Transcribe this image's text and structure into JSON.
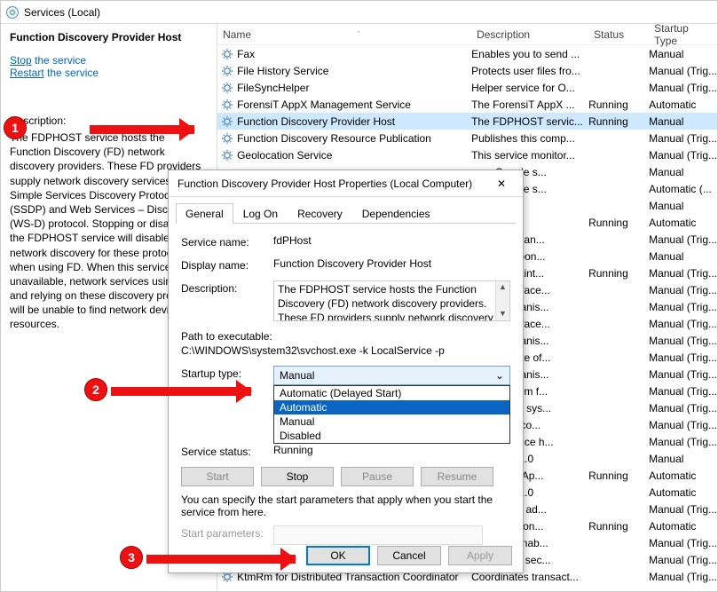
{
  "toolbar": {
    "title": "Services (Local)"
  },
  "left": {
    "title": "Function Discovery Provider Host",
    "stop_pre": "Stop",
    "stop_post": " the service",
    "restart_pre": "Restart",
    "restart_post": " the service",
    "desc_label": "Description:",
    "desc": "The FDPHOST service hosts the Function Discovery (FD) network discovery providers. These FD providers supply network discovery services for the Simple Services Discovery Protocol (SSDP) and Web Services – Discovery (WS-D) protocol. Stopping or disabling the FDPHOST service will disable network discovery for these protocols when using FD. When this service is unavailable, network services using FD and relying on these discovery protocols will be unable to find network devices or resources."
  },
  "columns": {
    "name": "Name",
    "desc": "Description",
    "status": "Status",
    "startup": "Startup Type"
  },
  "rows": [
    {
      "name": "Fax",
      "desc": "Enables you to send ...",
      "status": "",
      "startup": "Manual"
    },
    {
      "name": "File History Service",
      "desc": "Protects user files fro...",
      "status": "",
      "startup": "Manual (Trig..."
    },
    {
      "name": "FileSyncHelper",
      "desc": "Helper service for O...",
      "status": "",
      "startup": "Manual (Trig..."
    },
    {
      "name": "ForensiT AppX Management Service",
      "desc": "The ForensiT AppX ...",
      "status": "Running",
      "startup": "Automatic"
    },
    {
      "name": "Function Discovery Provider Host",
      "desc": "The FDPHOST servic...",
      "status": "Running",
      "startup": "Manual",
      "sel": true
    },
    {
      "name": "Function Discovery Resource Publication",
      "desc": "Publishes this comp...",
      "status": "",
      "startup": "Manual (Trig..."
    },
    {
      "name": "Geolocation Service",
      "desc": "This service monitor...",
      "status": "",
      "startup": "Manual (Trig..."
    },
    {
      "name": "",
      "desc": "your Google s...",
      "status": "",
      "startup": "Manual"
    },
    {
      "name": "",
      "desc": "your Google s...",
      "status": "",
      "startup": "Automatic (..."
    },
    {
      "name": "",
      "desc": "",
      "status": "",
      "startup": "Manual"
    },
    {
      "name": "",
      "desc": "",
      "status": "Running",
      "startup": "Automatic"
    },
    {
      "name": "",
      "desc": "ics performan...",
      "status": "",
      "startup": "Manual (Trig..."
    },
    {
      "name": "",
      "desc": "vice is respon...",
      "status": "",
      "startup": "Manual"
    },
    {
      "name": "",
      "desc": "tes and maint...",
      "status": "Running",
      "startup": "Manual (Trig..."
    },
    {
      "name": "",
      "desc": "es an interface...",
      "status": "",
      "startup": "Manual (Trig..."
    },
    {
      "name": "",
      "desc": "es a mechanis...",
      "status": "",
      "startup": "Manual (Trig..."
    },
    {
      "name": "",
      "desc": "es an interface...",
      "status": "",
      "startup": "Manual (Trig..."
    },
    {
      "name": "",
      "desc": "es a mechanis...",
      "status": "",
      "startup": "Manual (Trig..."
    },
    {
      "name": "",
      "desc": "ors the state of...",
      "status": "",
      "startup": "Manual (Trig..."
    },
    {
      "name": "",
      "desc": "es a mechanis...",
      "status": "",
      "startup": "Manual (Trig..."
    },
    {
      "name": "",
      "desc": "es a platform f...",
      "status": "",
      "startup": "Manual (Trig..."
    },
    {
      "name": "",
      "desc": "ronizes the sys...",
      "status": "",
      "startup": "Manual (Trig..."
    },
    {
      "name": "",
      "desc": "inates the co...",
      "status": "",
      "startup": "Manual (Trig..."
    },
    {
      "name": "",
      "desc": "EEXT service h...",
      "status": "",
      "startup": "Manual (Trig..."
    },
    {
      "name": "",
      "desc": "n: 1.61.251.0",
      "status": "",
      "startup": "Manual"
    },
    {
      "name": "",
      "desc": ") Dynamic Ap...",
      "status": "Running",
      "startup": "Automatic"
    },
    {
      "name": "",
      "desc": "n: 1.61.251.0",
      "status": "",
      "startup": "Automatic"
    },
    {
      "name": "",
      "desc": "es network ad...",
      "status": "",
      "startup": "Manual (Trig..."
    },
    {
      "name": "",
      "desc": "es tunnel con...",
      "status": "Running",
      "startup": "Automatic"
    },
    {
      "name": "",
      "desc": "ures and enab...",
      "status": "",
      "startup": "Manual (Trig..."
    },
    {
      "name": "",
      "desc": "et Protocol sec...",
      "status": "",
      "startup": "Manual (Trig..."
    },
    {
      "name": "KtmRm for Distributed Transaction Coordinator",
      "desc": "Coordinates transact...",
      "status": "",
      "startup": "Manual (Trig..."
    }
  ],
  "dialog": {
    "title": "Function Discovery Provider Host Properties (Local Computer)",
    "tabs": {
      "general": "General",
      "logon": "Log On",
      "recovery": "Recovery",
      "deps": "Dependencies"
    },
    "svc_name_lab": "Service name:",
    "svc_name": "fdPHost",
    "disp_lab": "Display name:",
    "disp": "Function Discovery Provider Host",
    "desc_lab": "Description:",
    "desc": "The FDPHOST service hosts the Function Discovery (FD) network discovery providers. These FD providers supply network discovery services for",
    "path_lab": "Path to executable:",
    "path": "C:\\WINDOWS\\system32\\svchost.exe -k LocalService -p",
    "startup_lab": "Startup type:",
    "combo_value": "Manual",
    "combo_opts": [
      "Automatic (Delayed Start)",
      "Automatic",
      "Manual",
      "Disabled"
    ],
    "combo_sel_idx": 1,
    "status_lab": "Service status:",
    "status": "Running",
    "btns": {
      "start": "Start",
      "stop": "Stop",
      "pause": "Pause",
      "resume": "Resume"
    },
    "note": "You can specify the start parameters that apply when you start the service from here.",
    "param_lab": "Start parameters:",
    "foot": {
      "ok": "OK",
      "cancel": "Cancel",
      "apply": "Apply"
    }
  },
  "badges": {
    "b1": "1",
    "b2": "2",
    "b3": "3"
  }
}
